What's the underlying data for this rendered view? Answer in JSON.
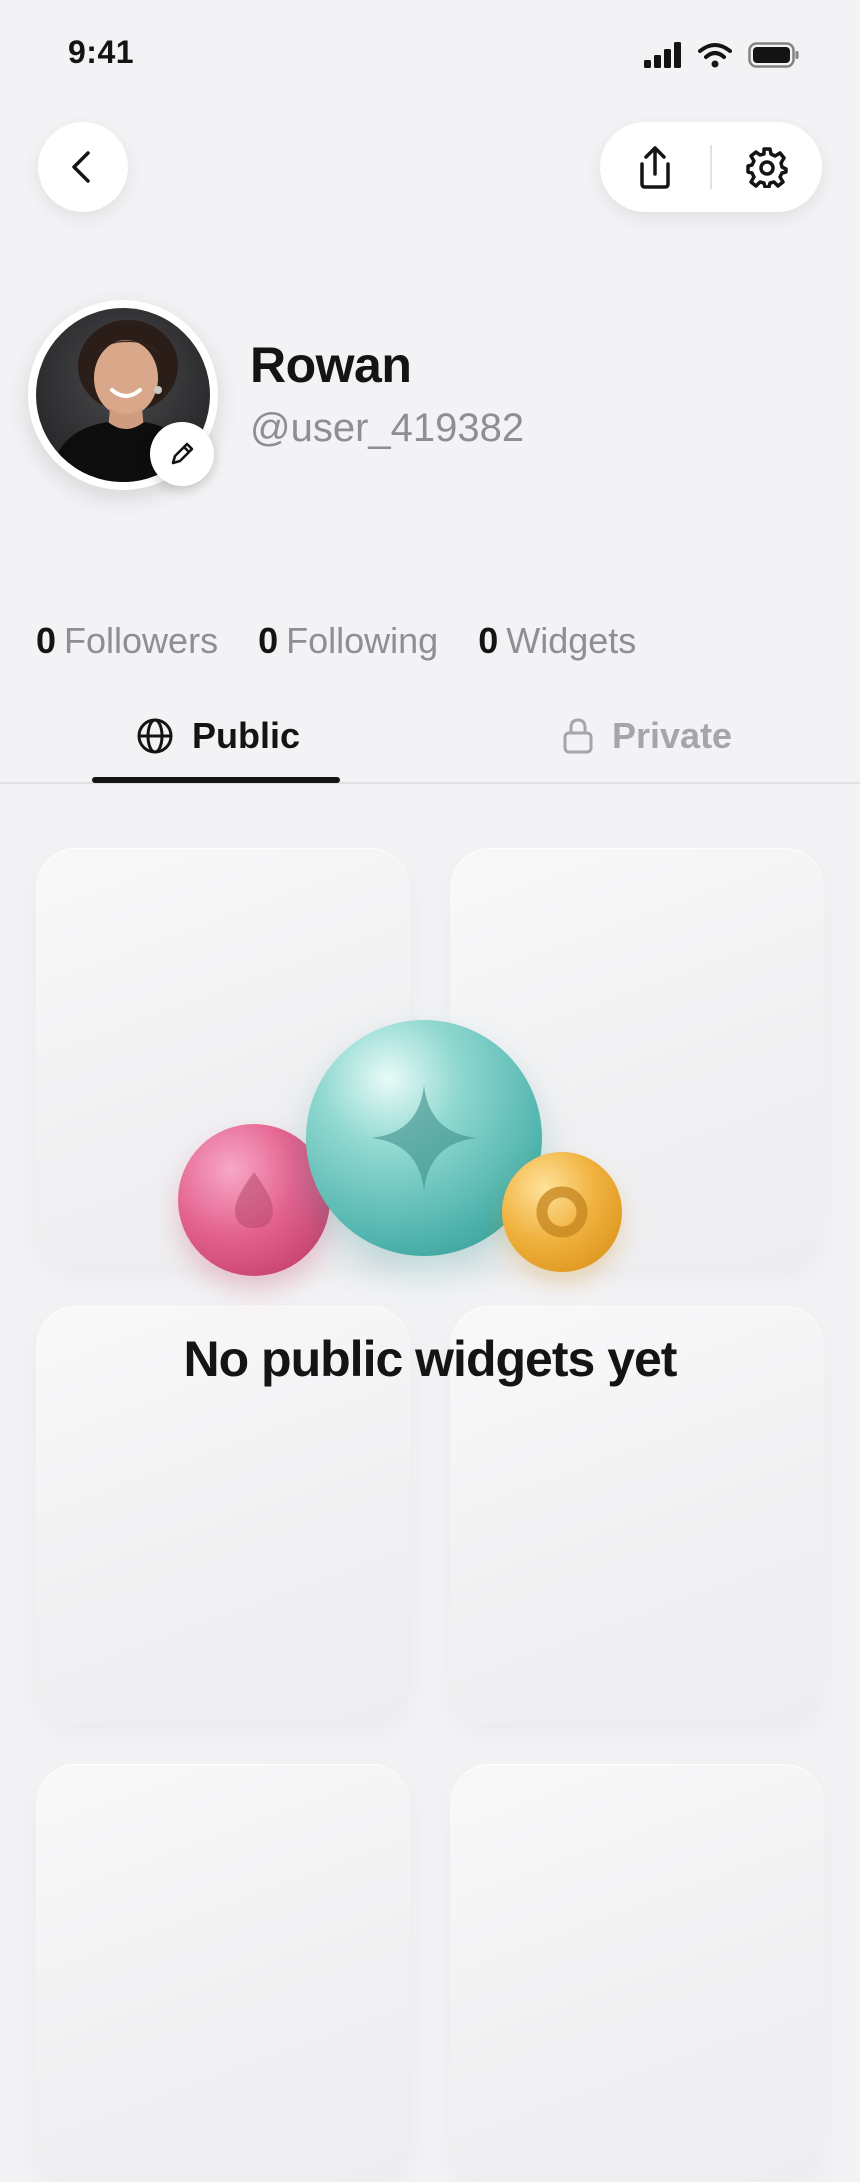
{
  "status_bar": {
    "time": "9:41"
  },
  "profile": {
    "name": "Rowan",
    "handle": "@user_419382"
  },
  "stats": [
    {
      "value": "0",
      "label": "Followers"
    },
    {
      "value": "0",
      "label": "Following"
    },
    {
      "value": "0",
      "label": "Widgets"
    }
  ],
  "tabs": {
    "public_label": "Public",
    "private_label": "Private",
    "active": "Public"
  },
  "empty_state": {
    "message": "No public widgets yet"
  },
  "icons": {
    "back": "chevron-left-icon",
    "share": "share-icon",
    "settings": "gear-icon",
    "edit": "pencil-icon",
    "public": "globe-icon",
    "private": "lock-icon"
  },
  "colors": {
    "accent": "#141414",
    "muted": "#8e8e93",
    "background": "#f3f3f5",
    "bubble_pink": "#e4628f",
    "bubble_teal": "#4fb3ad",
    "bubble_gold": "#f0b23e"
  }
}
